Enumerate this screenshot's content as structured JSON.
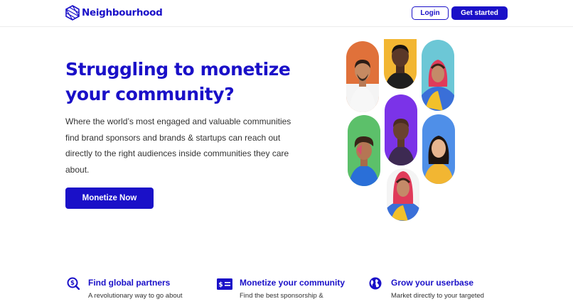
{
  "header": {
    "brand": "Neighbourhood",
    "login_label": "Login",
    "get_started_label": "Get started"
  },
  "hero": {
    "title_line1": "Struggling to monetize",
    "title_line2": "your community?",
    "description": "Where the world’s most engaged and valuable communities find brand sponsors and brands & startups can reach out directly to the right audiences inside communities they care about.",
    "cta_label": "Monetize Now"
  },
  "features": [
    {
      "icon": "search-dollar-icon",
      "title": "Find global partners",
      "text": "A revolutionary way to go about"
    },
    {
      "icon": "dollar-card-icon",
      "title": "Monetize your community",
      "text": "Find the best sponsorship &"
    },
    {
      "icon": "globe-icon",
      "title": "Grow your userbase",
      "text": "Market directly to your targeted"
    }
  ],
  "colors": {
    "brand": "#1a10c8",
    "pill_backgrounds": [
      "#e0713a",
      "#f2b632",
      "#6cc7d6",
      "#5cc06a",
      "#7b33e8",
      "#4f8fe8",
      "#ffffff"
    ]
  }
}
